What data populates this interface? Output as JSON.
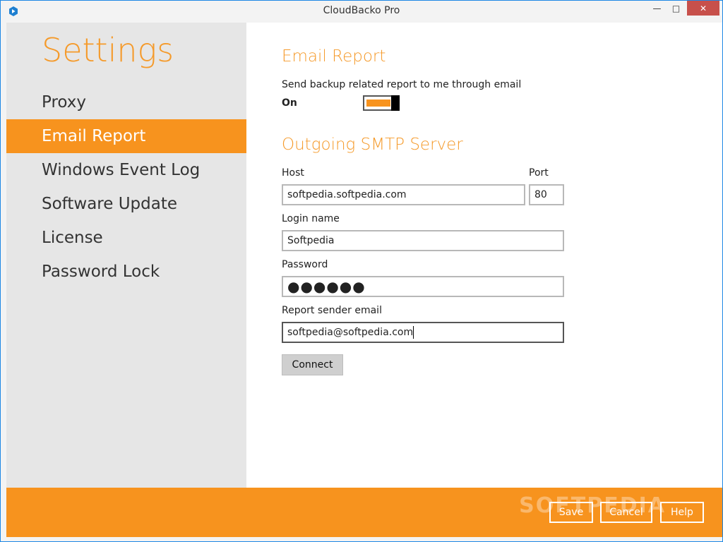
{
  "window": {
    "title": "CloudBacko Pro",
    "controls": {
      "minimize": "—",
      "maximize": "□",
      "close": "✕"
    }
  },
  "sidebar": {
    "title": "Settings",
    "items": [
      {
        "label": "Proxy",
        "active": false
      },
      {
        "label": "Email Report",
        "active": true
      },
      {
        "label": "Windows Event Log",
        "active": false
      },
      {
        "label": "Software Update",
        "active": false
      },
      {
        "label": "License",
        "active": false
      },
      {
        "label": "Password Lock",
        "active": false
      }
    ]
  },
  "email_report": {
    "title": "Email Report",
    "toggle_label": "Send backup related report to me through email",
    "toggle_state": "On"
  },
  "smtp": {
    "title": "Outgoing SMTP Server",
    "host_label": "Host",
    "host_value": "softpedia.softpedia.com",
    "port_label": "Port",
    "port_value": "80",
    "login_label": "Login name",
    "login_value": "Softpedia",
    "password_label": "Password",
    "password_value": "●●●●●●",
    "sender_label": "Report sender email",
    "sender_value": "softpedia@softpedia.com",
    "connect_label": "Connect"
  },
  "footer": {
    "save_label": "Save",
    "cancel_label": "Cancel",
    "help_label": "Help",
    "watermark": "SOFTPEDIA"
  },
  "colors": {
    "accent": "#f7931e",
    "accent_text": "#f59a2a",
    "sidebar_bg": "#e6e6e6",
    "close_button": "#c7504b"
  }
}
